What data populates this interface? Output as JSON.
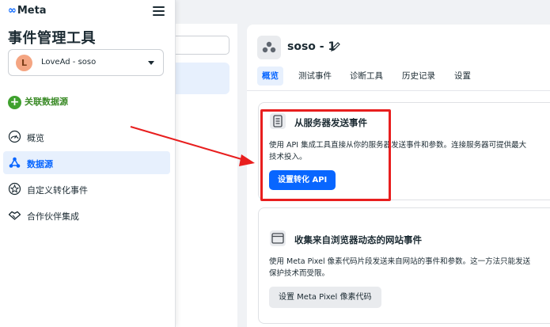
{
  "brand": {
    "logo_text": "Meta",
    "logo_symbol": "∞"
  },
  "sidebar": {
    "title": "事件管理工具",
    "account": {
      "avatar_letter": "L",
      "name": "LoveAd - soso"
    },
    "connect_label": "关联数据源",
    "items": [
      {
        "label": "概览",
        "icon": "gauge-icon",
        "active": false
      },
      {
        "label": "数据源",
        "icon": "data-sources-icon",
        "active": true
      },
      {
        "label": "自定义转化事件",
        "icon": "custom-conversion-icon",
        "active": false
      },
      {
        "label": "合作伙伴集成",
        "icon": "handshake-icon",
        "active": false
      }
    ]
  },
  "main": {
    "dataset_name": "soso - 1",
    "tabs": [
      {
        "label": "概览",
        "active": true
      },
      {
        "label": "测试事件",
        "active": false
      },
      {
        "label": "诊断工具",
        "active": false
      },
      {
        "label": "历史记录",
        "active": false
      },
      {
        "label": "设置",
        "active": false
      }
    ],
    "server_card": {
      "title": "从服务器发送事件",
      "description": "使用 API 集成工具直接从你的服务器发送事件和参数。连接服务器可提供最大",
      "description2": "技术投入。",
      "button": "设置转化 API"
    },
    "browser_card": {
      "title": "收集来自浏览器动态的网站事件",
      "description": "使用 Meta Pixel 像素代码片段发送来自网站的事件和参数。这一方法只能发送",
      "description2": "保护技术而受限。",
      "button": "设置 Meta Pixel 像素代码"
    }
  },
  "colors": {
    "accent": "#0866ff",
    "annotation": "#e81e1e",
    "connect": "#3a8a26"
  }
}
